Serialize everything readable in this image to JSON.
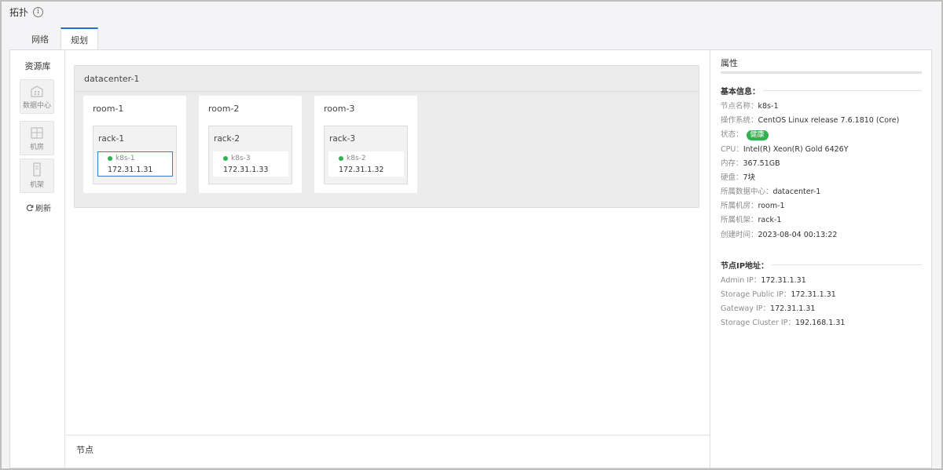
{
  "header": {
    "title": "拓扑",
    "info_icon": "info-icon"
  },
  "tabs": [
    {
      "label": "网络",
      "active": false
    },
    {
      "label": "规划",
      "active": true
    }
  ],
  "library": {
    "title": "资源库",
    "items": [
      {
        "label": "数据中心",
        "icon": "datacenter-icon"
      },
      {
        "label": "机房",
        "icon": "room-icon"
      },
      {
        "label": "机架",
        "icon": "rack-icon"
      }
    ],
    "refresh_label": "刷新"
  },
  "topology": {
    "datacenter": "datacenter-1",
    "rooms": [
      {
        "name": "room-1",
        "rack": "rack-1",
        "node_name": "k8s-1",
        "node_ip": "172.31.1.31",
        "selected": true
      },
      {
        "name": "room-2",
        "rack": "rack-2",
        "node_name": "k8s-3",
        "node_ip": "172.31.1.33",
        "selected": false
      },
      {
        "name": "room-3",
        "rack": "rack-3",
        "node_name": "k8s-2",
        "node_ip": "172.31.1.32",
        "selected": false
      }
    ]
  },
  "nodes_bar": {
    "title": "节点"
  },
  "properties": {
    "title": "属性",
    "basic_title": "基本信息：",
    "basic": [
      {
        "k": "节点名称：",
        "v": "k8s-1"
      },
      {
        "k": "操作系统：",
        "v": "CentOS Linux release 7.6.1810 (Core)"
      },
      {
        "k": "状态：",
        "v": "健康",
        "badge": true
      },
      {
        "k": "CPU：",
        "v": "Intel(R) Xeon(R) Gold 6426Y"
      },
      {
        "k": "内存：",
        "v": "367.51GB"
      },
      {
        "k": "硬盘：",
        "v": "7块"
      },
      {
        "k": "所属数据中心：",
        "v": "datacenter-1"
      },
      {
        "k": "所属机房：",
        "v": "room-1"
      },
      {
        "k": "所属机架：",
        "v": "rack-1"
      },
      {
        "k": "创建时间：",
        "v": "2023-08-04 00:13:22"
      }
    ],
    "ip_title": "节点IP地址：",
    "ips": [
      {
        "k": "Admin IP：",
        "v": "172.31.1.31"
      },
      {
        "k": "Storage Public IP：",
        "v": "172.31.1.31"
      },
      {
        "k": "Gateway IP：",
        "v": "172.31.1.31"
      },
      {
        "k": "Storage Cluster IP：",
        "v": "192.168.1.31"
      }
    ]
  },
  "colors": {
    "accent": "#1e6fd0",
    "healthy": "#2fb24f"
  }
}
